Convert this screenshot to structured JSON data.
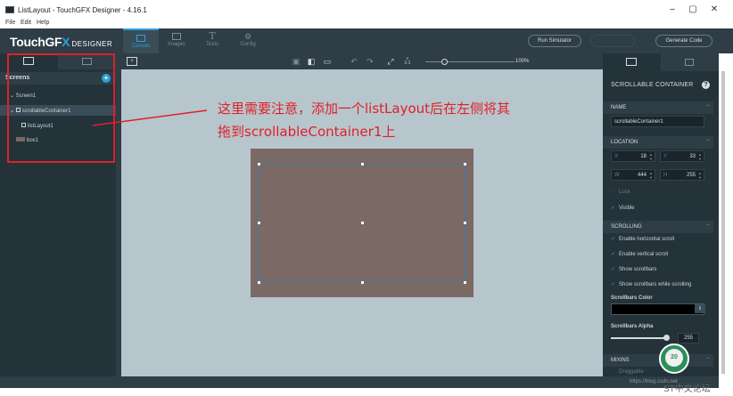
{
  "window": {
    "title": "ListLayout - TouchGFX Designer - 4.16.1",
    "minimize_glyph": "–",
    "maximize_glyph": "▢",
    "close_glyph": "✕"
  },
  "menu": [
    "File",
    "Edit",
    "Help"
  ],
  "brand": {
    "main": "TouchGF",
    "x": "X",
    "sub": "DESIGNER"
  },
  "nav_tabs": [
    {
      "label": "Canvas",
      "icon": "canvas-icon",
      "active": true
    },
    {
      "label": "Images",
      "icon": "images-icon",
      "active": false
    },
    {
      "label": "Texts",
      "icon": "texts-icon",
      "active": false
    },
    {
      "label": "Config",
      "icon": "config-icon",
      "active": false
    }
  ],
  "toolbar_buttons": {
    "run_simulator": "Run Simulator",
    "generate_code": "Generate Code"
  },
  "left_panel": {
    "section": "Screens",
    "tree": [
      {
        "label": "Screen1",
        "level": 0
      },
      {
        "label": "scrollableContainer1",
        "level": 1,
        "selected": true
      },
      {
        "label": "listLayout1",
        "level": 2
      },
      {
        "label": "box1",
        "level": 1
      }
    ]
  },
  "canvas": {
    "zoom_label": "100%",
    "fit_label": "1:1"
  },
  "annotation": {
    "line1": "这里需要注意，添加一个listLayout后在左侧将其",
    "line2": "拖到scrollableContainer1上"
  },
  "right_panel": {
    "widget_type": "SCROLLABLE CONTAINER",
    "help": "?",
    "name_section": "NAME",
    "name_value": "scrollableContainer1",
    "location_section": "LOCATION",
    "x": {
      "label": "X",
      "value": "18"
    },
    "y": {
      "label": "Y",
      "value": "33"
    },
    "w": {
      "label": "W",
      "value": "444"
    },
    "h": {
      "label": "H",
      "value": "255"
    },
    "lock": "Lock",
    "visible": "Visible",
    "scrolling_section": "SCROLLING",
    "options": [
      "Enable horizontal scroll",
      "Enable vertical scroll",
      "Show scrollbars",
      "Show scrollbars while scrolling"
    ],
    "scrollbars_color_label": "Scrollbars Color",
    "scrollbars_alpha_label": "Scrollbars Alpha",
    "scrollbars_alpha_value": "255",
    "mixins_section": "MIXINS",
    "draggable": "Draggable"
  },
  "status": {
    "url": "https://blog.csdn.net",
    "watermark": "ST中文论坛",
    "badge_text": "20"
  },
  "colors": {
    "accent": "#2aa1d8",
    "panel": "#24323a",
    "toolbar": "#2e3d46",
    "canvas_bg": "#b7c6cc",
    "widget_fill": "#7a6965",
    "annotation_red": "#e0202a"
  }
}
